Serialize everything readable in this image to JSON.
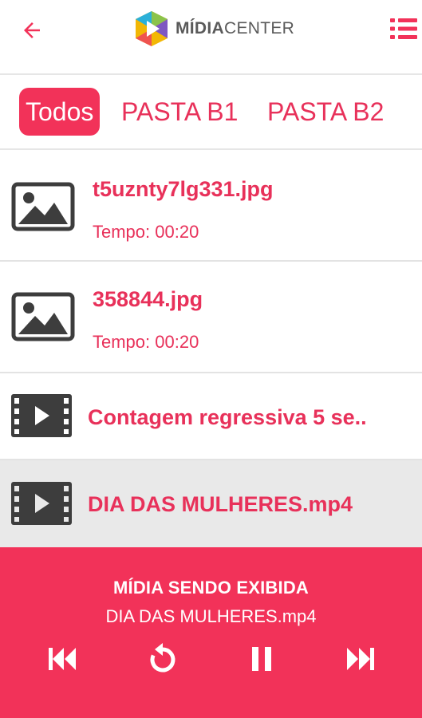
{
  "header": {
    "logo_bold": "MÍDIA",
    "logo_light": "CENTER",
    "back_icon": "arrow-left-icon",
    "menu_icon": "list-menu-icon"
  },
  "tabs": [
    {
      "label": "Todos",
      "active": true
    },
    {
      "label": "PASTA B1",
      "active": false
    },
    {
      "label": "PASTA B2",
      "active": false
    }
  ],
  "media_list": [
    {
      "type": "image",
      "icon": "image-icon",
      "name": "t5uznty7lg331.jpg",
      "time": "Tempo: 00:20"
    },
    {
      "type": "image",
      "icon": "image-icon",
      "name": "358844.jpg",
      "time": "Tempo: 00:20"
    },
    {
      "type": "video",
      "icon": "video-file-icon",
      "name": "Contagem regressiva 5 se.."
    },
    {
      "type": "video",
      "icon": "video-file-icon",
      "name": "DIA DAS MULHERES.mp4",
      "selected": true
    }
  ],
  "player": {
    "label": "MÍDIA SENDO EXIBIDA",
    "current_media": "DIA DAS MULHERES.mp4"
  },
  "colors": {
    "accent": "#f23259",
    "accent_text": "#e8315a",
    "icon_dark": "#3d3d3d",
    "selected_row": "#e9e9e9"
  }
}
